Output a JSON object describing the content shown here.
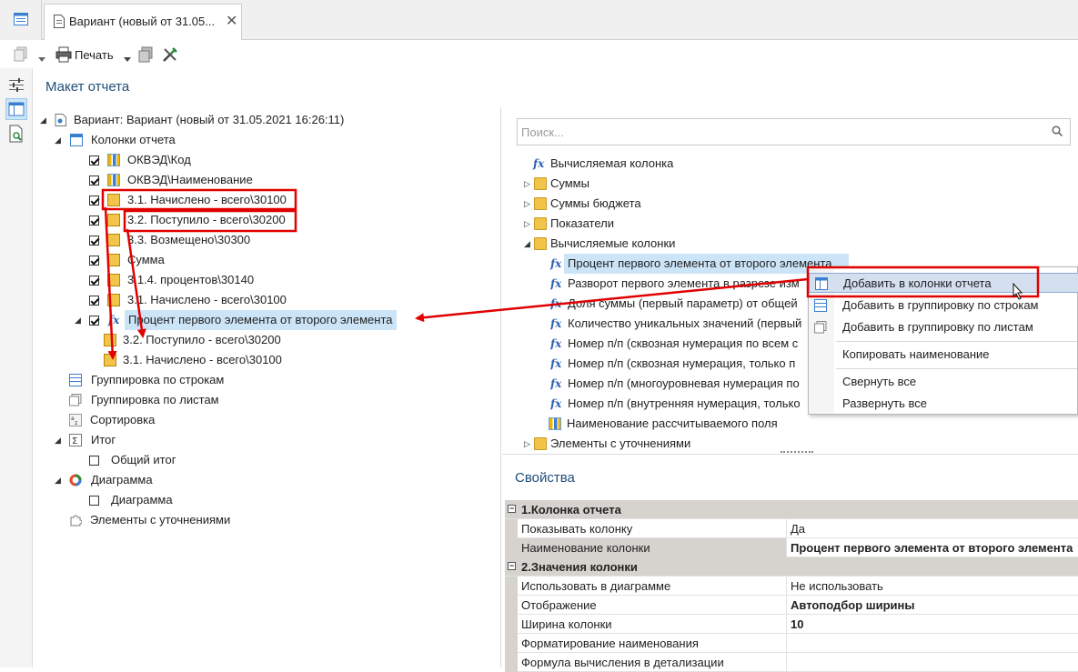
{
  "tab": {
    "title": "Вариант (новый от 31.05...",
    "close": "✕"
  },
  "toolbar": {
    "print_label": "Печать"
  },
  "left_panel": {
    "title": "Макет отчета",
    "root": "Вариант: Вариант (новый от 31.05.2021 16:26:11)",
    "columns_node": "Колонки отчета",
    "columns": [
      "ОКВЭД\\Код",
      "ОКВЭД\\Наименование",
      "3.1. Начислено - всего\\30100",
      "3.2. Поступило - всего\\30200",
      "3.3. Возмещено\\30300",
      "Сумма",
      "3.1.4. процентов\\30140",
      "3.1. Начислено - всего\\30100",
      "Процент первого элемента от второго элемента"
    ],
    "sub_items": [
      "3.2. Поступило - всего\\30200",
      "3.1. Начислено - всего\\30100"
    ],
    "groups": [
      "Группировка по строкам",
      "Группировка по листам",
      "Сортировка",
      "Итог",
      "Общий итог",
      "Диаграмма",
      "Диаграмма",
      "Элементы с уточнениями"
    ]
  },
  "search": {
    "placeholder": "Поиск..."
  },
  "right_tree": {
    "items": [
      "Вычисляемая колонка",
      "Суммы",
      "Суммы бюджета",
      "Показатели",
      "Вычисляемые колонки",
      "Процент первого элемента от второго элемента",
      "Разворот первого элемента в разрезе изм",
      "Доля суммы (первый параметр) от общей",
      "Количество уникальных значений (первый",
      "Номер п/п (сквозная нумерация по всем с",
      "Номер п/п (сквозная нумерация, только п",
      "Номер п/п (многоуровневая нумерация по",
      "Номер п/п (внутренняя нумерация, только",
      "Наименование рассчитываемого поля",
      "Элементы с уточнениями"
    ]
  },
  "context_menu": {
    "items": [
      "Добавить в колонки отчета",
      "Добавить в группировку по строкам",
      "Добавить в группировку по листам",
      "Копировать наименование",
      "Свернуть все",
      "Развернуть все"
    ]
  },
  "properties": {
    "title": "Свойства",
    "cat1": "1.Колонка отчета",
    "show_col": {
      "name": "Показывать колонку",
      "value": "Да"
    },
    "col_name": {
      "name": "Наименование колонки",
      "value": "Процент первого элемента от второго элемента"
    },
    "cat2": "2.Значения колонки",
    "use_chart": {
      "name": "Использовать в диаграмме",
      "value": "Не использовать"
    },
    "display": {
      "name": "Отображение",
      "value": "Автоподбор ширины"
    },
    "width": {
      "name": "Ширина колонки",
      "value": "10"
    },
    "name_format": {
      "name": "Форматирование наименования",
      "value": ""
    },
    "detail_formula": {
      "name": "Формула вычисления в детализации",
      "value": ""
    }
  },
  "colors": {
    "accent": "#1f4e79",
    "selection": "#cce4f7",
    "annotation": "#e00000",
    "menu_highlight": "#d4dff0"
  }
}
